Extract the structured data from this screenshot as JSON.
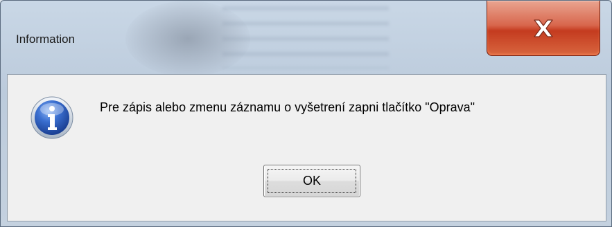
{
  "window": {
    "title": "Information"
  },
  "dialog": {
    "message": "Pre zápis alebo zmenu záznamu o vyšetrení zapni tlačítko \"Oprava\"",
    "ok_label": "OK",
    "icon": "information-icon"
  },
  "colors": {
    "close_button": "#c9442a",
    "info_icon_blue": "#2f5fbf",
    "dialog_background": "#f0f0f0"
  }
}
